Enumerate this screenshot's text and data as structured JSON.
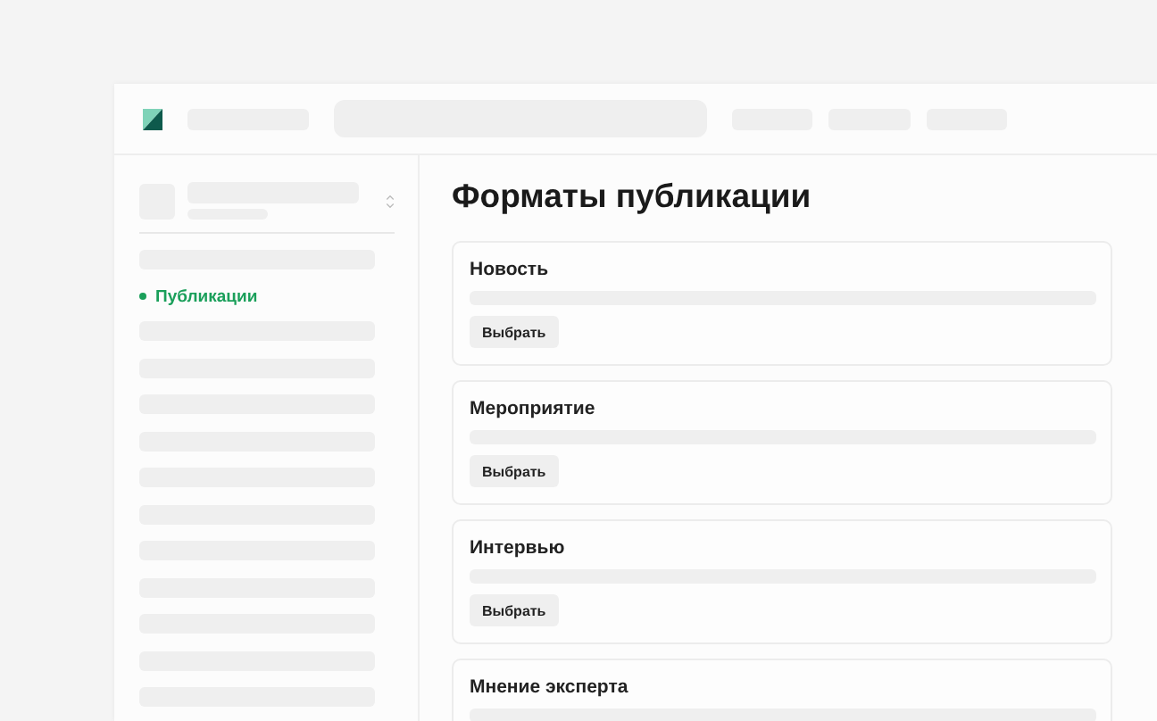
{
  "sidebar": {
    "items": [
      {
        "label": "Публикации",
        "selected": true
      }
    ]
  },
  "page": {
    "title": "Форматы публикации"
  },
  "formats": [
    {
      "title": "Новость",
      "button": "Выбрать"
    },
    {
      "title": "Мероприятие",
      "button": "Выбрать"
    },
    {
      "title": "Интервью",
      "button": "Выбрать"
    },
    {
      "title": "Мнение эксперта"
    }
  ]
}
